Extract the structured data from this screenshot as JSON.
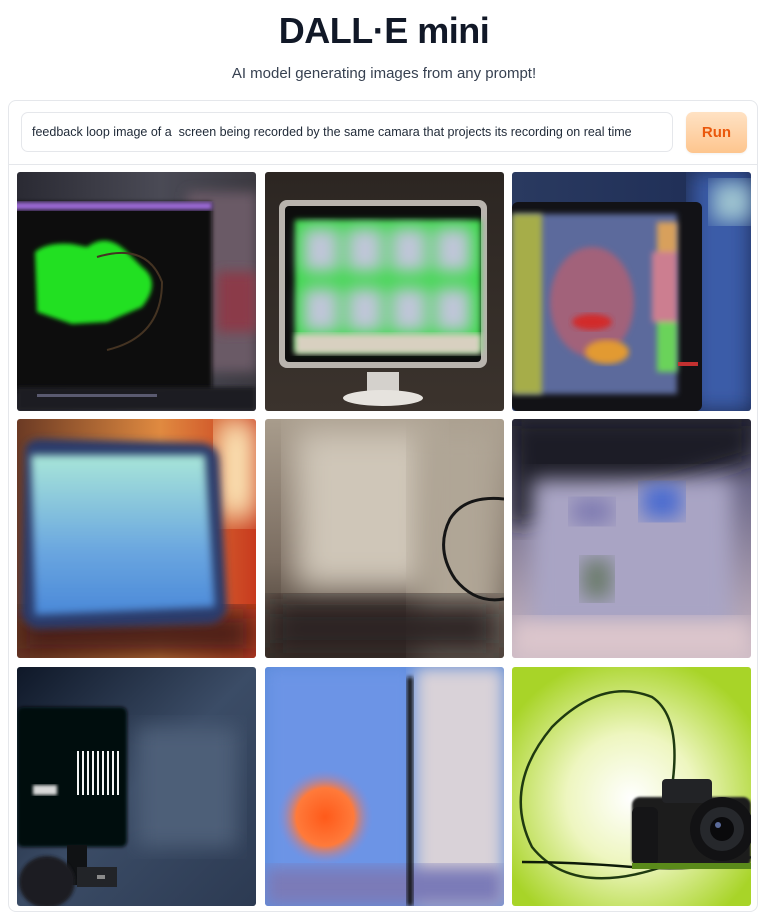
{
  "app": {
    "title": "DALL·E mini",
    "subtitle": "AI model generating images from any prompt!"
  },
  "prompt": {
    "value": "feedback loop image of a  screen being recorded by the same camara that projects its recording on real time",
    "run_label": "Run"
  },
  "colors": {
    "accent_text": "#ea580c",
    "accent_bg": "#fdc58e",
    "border": "#e5e7eb"
  },
  "results": [
    {
      "name": "generated-image-1",
      "content": "dark monitor with green shape"
    },
    {
      "name": "generated-image-2",
      "content": "computer monitor showing green grid"
    },
    {
      "name": "generated-image-3",
      "content": "tablet screen with glitched face"
    },
    {
      "name": "generated-image-4",
      "content": "blurry cyan screen with orange glow"
    },
    {
      "name": "generated-image-5",
      "content": "blurry beige wall with black cable"
    },
    {
      "name": "generated-image-6",
      "content": "blurry lavender screen"
    },
    {
      "name": "generated-image-7",
      "content": "dark blue scene with small screen"
    },
    {
      "name": "generated-image-8",
      "content": "blue screen with orange dot"
    },
    {
      "name": "generated-image-9",
      "content": "camera with cable on green background"
    }
  ]
}
